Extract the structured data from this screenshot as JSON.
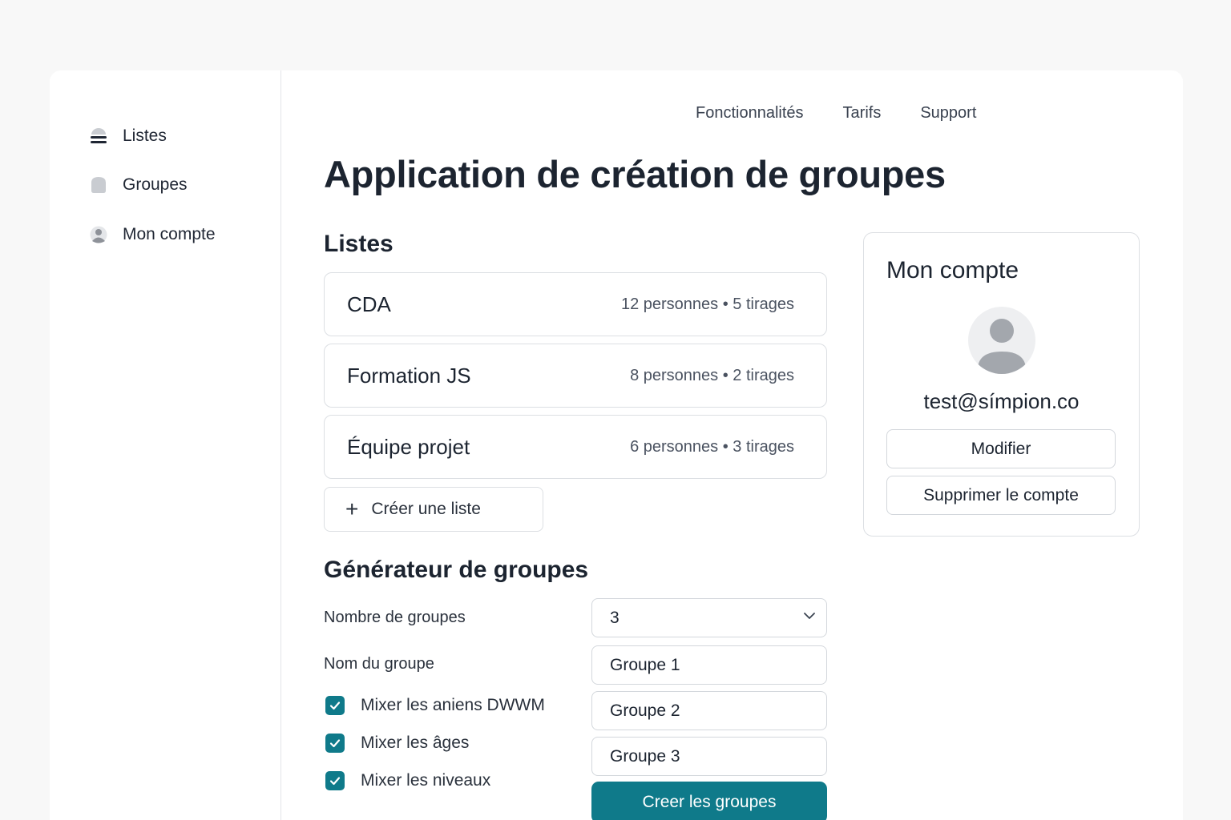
{
  "sidebar": {
    "items": [
      {
        "label": "Listes",
        "icon": "list-icon"
      },
      {
        "label": "Groupes",
        "icon": "groups-icon"
      },
      {
        "label": "Mon compte",
        "icon": "user-icon"
      }
    ]
  },
  "topnav": {
    "items": [
      "Fonctionnalités",
      "Tarifs",
      "Support"
    ]
  },
  "page": {
    "title": "Application de création de groupes"
  },
  "lists": {
    "heading": "Listes",
    "items": [
      {
        "name": "CDA",
        "meta": "12 personnes • 5 tirages"
      },
      {
        "name": "Formation JS",
        "meta": "8 personnes • 2 tirages"
      },
      {
        "name": "Équipe projet",
        "meta": "6 personnes • 3 tirages"
      }
    ],
    "create_label": "Créer une liste"
  },
  "generator": {
    "heading": "Générateur de groupes",
    "count_label": "Nombre de groupes",
    "count_value": "3",
    "name_label": "Nom du groupe",
    "options": [
      {
        "label": "Mixer les aniens DWWM",
        "checked": true
      },
      {
        "label": "Mixer les âges",
        "checked": true
      },
      {
        "label": "Mixer les niveaux",
        "checked": true
      }
    ],
    "group_names": [
      "Groupe 1",
      "Groupe 2",
      "Groupe 3"
    ],
    "submit_label": "Creer les groupes"
  },
  "account": {
    "title": "Mon compte",
    "email": "test@símpion.co",
    "edit_label": "Modifier",
    "delete_label": "Supprimer le compte"
  },
  "colors": {
    "accent": "#0f7a8a",
    "text": "#1c2430",
    "border": "#dcdfe3"
  }
}
